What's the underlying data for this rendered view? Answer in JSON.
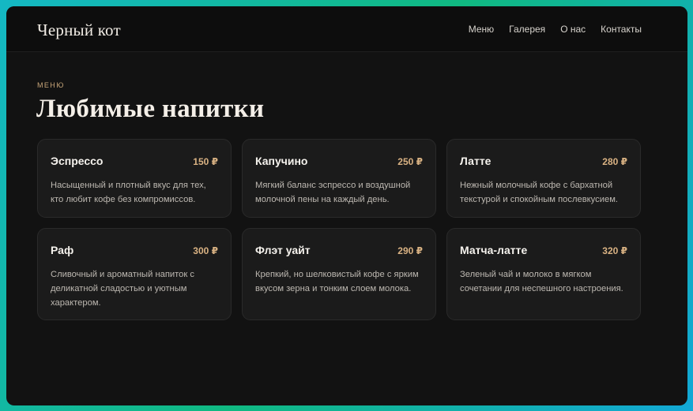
{
  "header": {
    "brand": "Черный кот",
    "nav": [
      "Меню",
      "Галерея",
      "О нас",
      "Контакты"
    ]
  },
  "section": {
    "eyebrow": "МЕНЮ",
    "title": "Любимые напитки"
  },
  "items": [
    {
      "name": "Эспрессо",
      "price": "150 ₽",
      "desc": "Насыщенный и плотный вкус для тех, кто любит кофе без компромиссов."
    },
    {
      "name": "Капучино",
      "price": "250 ₽",
      "desc": "Мягкий баланс эспрессо и воздушной молочной пены на каждый день."
    },
    {
      "name": "Латте",
      "price": "280 ₽",
      "desc": "Нежный молочный кофе с бархатной текстурой и спокойным послевкусием."
    },
    {
      "name": "Раф",
      "price": "300 ₽",
      "desc": "Сливочный и ароматный напиток с деликатной сладостью и уютным характером."
    },
    {
      "name": "Флэт уайт",
      "price": "290 ₽",
      "desc": "Крепкий, но шелковистый кофе с ярким вкусом зерна и тонким слоем молока."
    },
    {
      "name": "Матча-латте",
      "price": "320 ₽",
      "desc": "Зеленый чай и молоко в мягком сочетании для неспешного настроения."
    }
  ],
  "colors": {
    "accent": "#d9b283",
    "background": "#121212",
    "card": "#1b1b1b",
    "frame_gradient": [
      "#14b8c4",
      "#10b981"
    ]
  }
}
